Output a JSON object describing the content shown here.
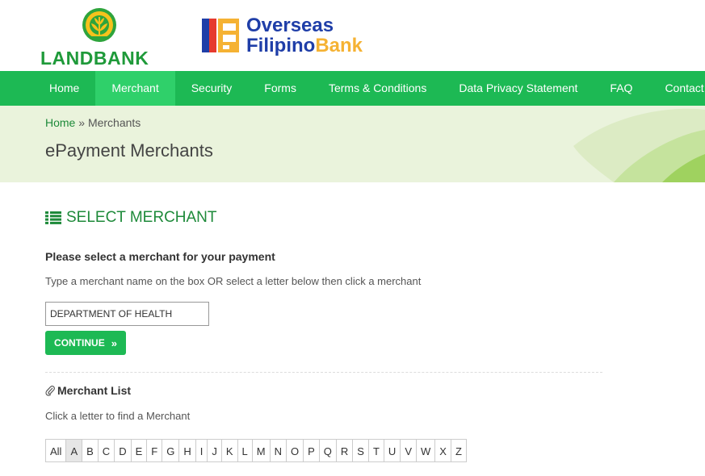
{
  "header": {
    "landbank_logo_text": "LANDBANK",
    "ofb_line1": "Overseas",
    "ofb_line2_a": "Filipino",
    "ofb_line2_b": "Bank"
  },
  "nav": {
    "items": [
      "Home",
      "Merchant",
      "Security",
      "Forms",
      "Terms & Conditions",
      "Data Privacy Statement",
      "FAQ",
      "Contact Us"
    ],
    "active": "Merchant"
  },
  "breadcrumb": {
    "home": "Home",
    "separator": "»",
    "current": "Merchants"
  },
  "page_title": "ePayment Merchants",
  "select_section": {
    "title": "SELECT MERCHANT",
    "prompt": "Please select a merchant for your payment",
    "hint": "Type a merchant name on the box OR select a letter below then click a merchant",
    "input_value": "DEPARTMENT OF HEALTH",
    "continue_label": "CONTINUE",
    "continue_icon": "»"
  },
  "merchant_list": {
    "title": "Merchant List",
    "hint": "Click a letter to find a Merchant",
    "letters": [
      "All",
      "A",
      "B",
      "C",
      "D",
      "E",
      "F",
      "G",
      "H",
      "I",
      "J",
      "K",
      "L",
      "M",
      "N",
      "O",
      "P",
      "Q",
      "R",
      "S",
      "T",
      "U",
      "V",
      "W",
      "X",
      "Z"
    ],
    "active_letter": "A"
  },
  "colors": {
    "nav_green": "#1db954",
    "title_green": "#1e8a3a",
    "banner_bg": "#eaf3dc",
    "ofb_blue": "#1f3ea8",
    "ofb_gold": "#f5b233"
  }
}
